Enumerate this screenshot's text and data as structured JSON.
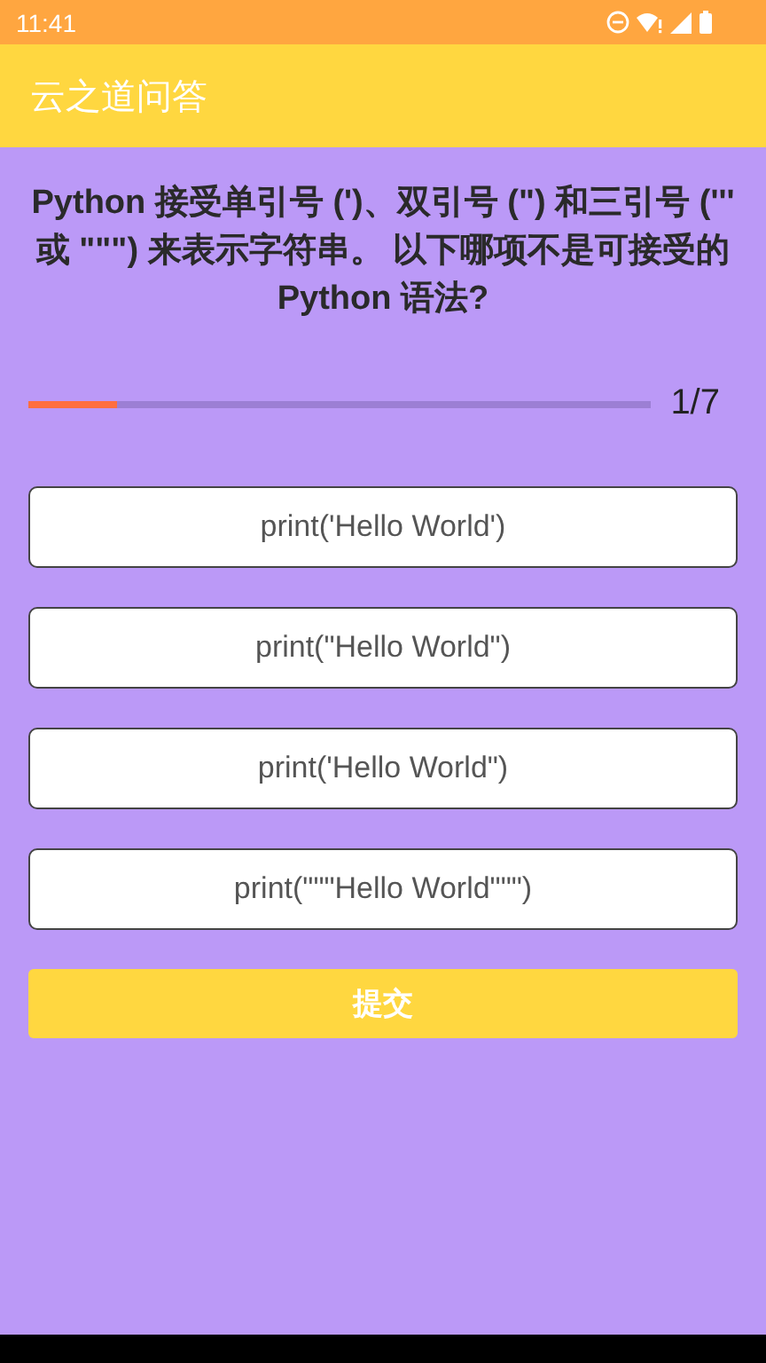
{
  "status_bar": {
    "time": "11:41"
  },
  "app_bar": {
    "title": "云之道问答"
  },
  "question": {
    "text": "Python 接受单引号 (')、双引号 (\") 和三引号 (''' 或 \"\"\") 来表示字符串。 以下哪项不是可接受的 Python 语法?"
  },
  "progress": {
    "level": 0.143,
    "counter": "1/7"
  },
  "options": [
    {
      "label": "print('Hello World')"
    },
    {
      "label": "print(\"Hello World\")"
    },
    {
      "label": "print('Hello World\")"
    },
    {
      "label": "print(\"\"\"Hello World\"\"\")"
    }
  ],
  "submit_button": {
    "label": "提交"
  }
}
